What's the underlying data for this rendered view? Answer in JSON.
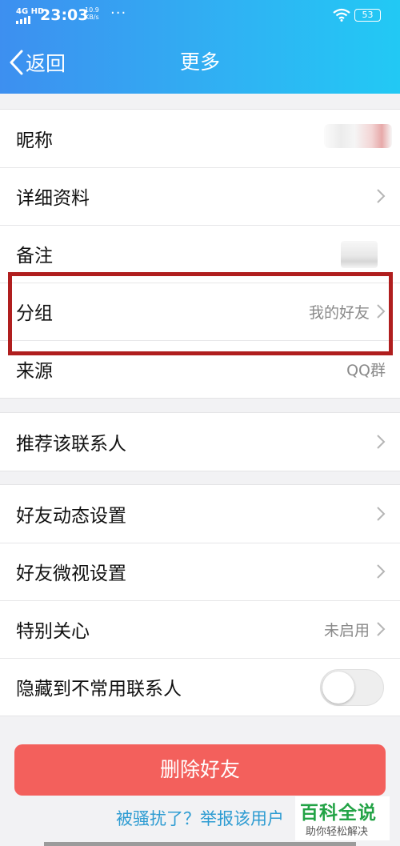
{
  "status_bar": {
    "network": "4G HD",
    "time": "23:03",
    "speed_value": "10.9",
    "speed_unit": "KB/s",
    "dots": "···",
    "battery": "53"
  },
  "nav": {
    "back_label": "返回",
    "title": "更多"
  },
  "group1": [
    {
      "label": "昵称",
      "value": ""
    },
    {
      "label": "详细资料",
      "value": ""
    },
    {
      "label": "备注",
      "value": ""
    },
    {
      "label": "分组",
      "value": "我的好友"
    },
    {
      "label": "来源",
      "value": "QQ群"
    }
  ],
  "group2": [
    {
      "label": "推荐该联系人"
    }
  ],
  "group3": [
    {
      "label": "好友动态设置",
      "value": ""
    },
    {
      "label": "好友微视设置",
      "value": ""
    },
    {
      "label": "特别关心",
      "value": "未启用"
    },
    {
      "label": "隐藏到不常用联系人",
      "toggle_on": false
    }
  ],
  "actions": {
    "delete_label": "删除好友",
    "report_label": "被骚扰了？举报该用户"
  },
  "watermark": {
    "title": "百科全说",
    "subtitle": "助你轻松解决"
  },
  "colors": {
    "header_start": "#3d8ff0",
    "header_end": "#22c9f4",
    "delete_button": "#f3605c",
    "link": "#2e9cd2",
    "highlight_box": "#b01e1e",
    "watermark_green": "#23a346"
  }
}
